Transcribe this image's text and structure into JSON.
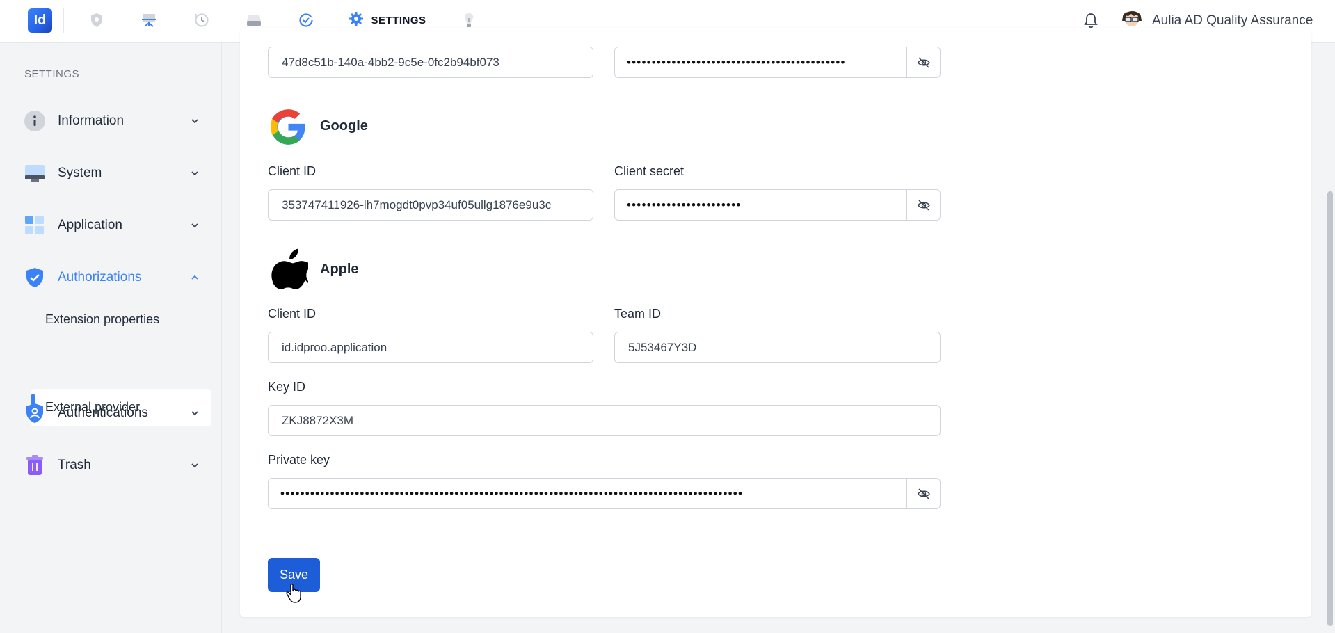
{
  "topbar": {
    "logo_text": "Id",
    "active_tab_label": "SETTINGS",
    "user_name": "Aulia AD Quality Assurance",
    "icons": [
      "shield-icon",
      "presentation-icon",
      "history-icon",
      "drive-icon",
      "check-circle-icon",
      "gear-icon",
      "bulb-icon",
      "bell-icon"
    ]
  },
  "sidebar": {
    "title": "SETTINGS",
    "items": [
      {
        "label": "Information",
        "icon": "info-icon"
      },
      {
        "label": "System",
        "icon": "monitor-icon"
      },
      {
        "label": "Application",
        "icon": "grid-icon"
      },
      {
        "label": "Authorizations",
        "icon": "shield-check-icon"
      },
      {
        "label": "Authentications",
        "icon": "shield-user-icon"
      },
      {
        "label": "Trash",
        "icon": "trash-icon"
      }
    ],
    "sub_items": [
      {
        "label": "Extension properties"
      },
      {
        "label": "External provider"
      }
    ]
  },
  "main": {
    "top_row": {
      "client_id_value": "47d8c51b-140a-4bb2-9c5e-0fc2b94bf073",
      "secret_dots": "••••••••••••••••••••••••••••••••••••••••••••"
    },
    "google": {
      "title": "Google",
      "client_id_label": "Client ID",
      "client_id_value": "353747411926-lh7mogdt0pvp34uf05ullg1876e9u3c",
      "client_secret_label": "Client secret",
      "client_secret_dots": "•••••••••••••••••••••••"
    },
    "apple": {
      "title": "Apple",
      "client_id_label": "Client ID",
      "client_id_value": "id.idproo.application",
      "team_id_label": "Team ID",
      "team_id_value": "5J53467Y3D",
      "key_id_label": "Key ID",
      "key_id_value": "ZKJ8872X3M",
      "private_key_label": "Private key",
      "private_key_dots": "•••••••••••••••••••••••••••••••••••••••••••••••••••••••••••••••••••••••••••••••••••••••••••••"
    },
    "save_label": "Save"
  },
  "colors": {
    "accent": "#3b82f6",
    "button": "#1d5ed8"
  }
}
